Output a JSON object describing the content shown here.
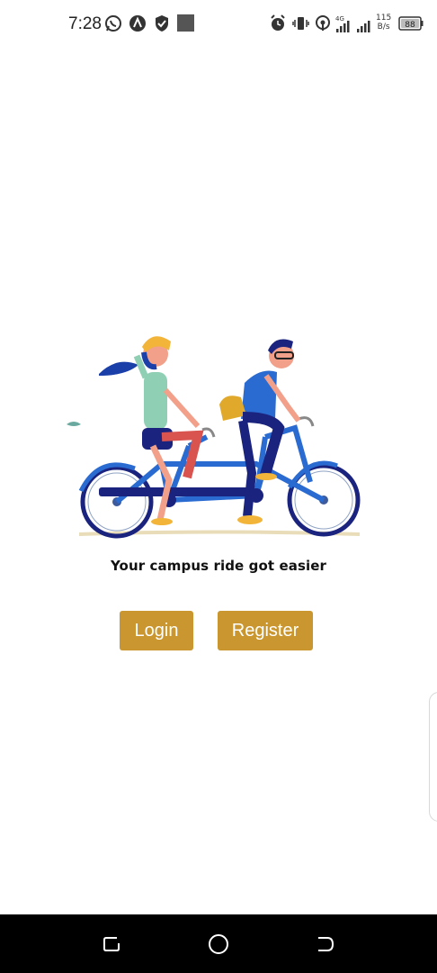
{
  "status_bar": {
    "time": "7:28",
    "network_speed_value": "115",
    "network_speed_unit": "B/s",
    "network_type": "4G",
    "battery_level": "88"
  },
  "main": {
    "tagline": "Your campus ride got easier",
    "login_label": "Login",
    "register_label": "Register"
  },
  "colors": {
    "button": "#c9962f",
    "nav_bar": "#000000"
  }
}
